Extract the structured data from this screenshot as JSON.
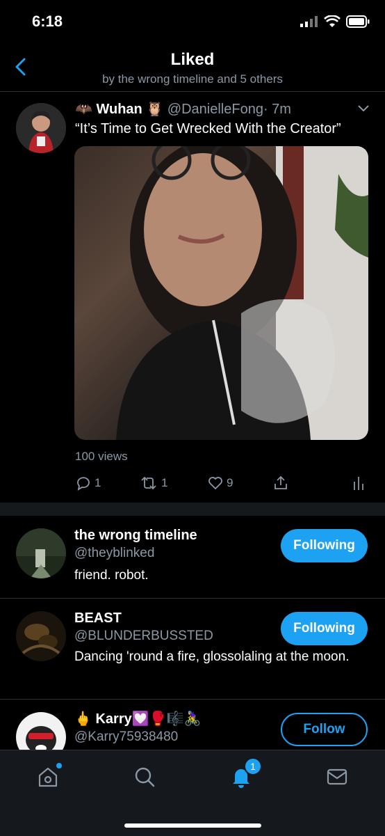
{
  "status": {
    "time": "6:18"
  },
  "nav": {
    "title": "Liked",
    "subtitle": "by the wrong timeline and 5 others"
  },
  "tweet": {
    "name": "Wuhan",
    "name_prefix_emoji": "🦇",
    "name_suffix_emoji": "🦉",
    "handle": "@DanielleFong",
    "time": "· 7m",
    "text": "“It’s Time to Get Wrecked With the Creator”",
    "views": "100 views",
    "replies": "1",
    "retweets": "1",
    "likes": "9"
  },
  "users": [
    {
      "name": "the wrong timeline",
      "handle": "@theyblinked",
      "bio": "friend. robot.",
      "button": "Following"
    },
    {
      "name": "BEAST",
      "handle": "@BLUNDERBUSSTED",
      "bio": "Dancing 'round a fire, glossolaling at the moon.",
      "button": "Following"
    },
    {
      "name": "Karry",
      "name_prefix": "🖕",
      "name_suffix": "💟🥊🎼🚴‍♀️",
      "handle": "@Karry75938480",
      "bio": "",
      "button": "Follow"
    }
  ],
  "tabbar": {
    "notifications_badge": "1"
  },
  "colors": {
    "accent": "#1da1f2",
    "background": "#000000",
    "secondary_text": "#8b98a5"
  }
}
